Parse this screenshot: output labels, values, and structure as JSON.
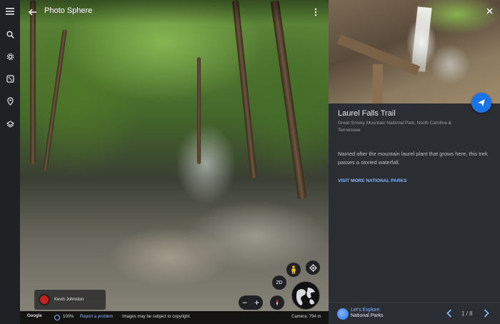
{
  "viewer": {
    "title": "Photo Sphere",
    "contributor": "Kevin Johnston",
    "controls": {
      "zoom_minus": "−",
      "zoom_plus": "+",
      "mode_2d": "2D"
    },
    "footer": {
      "logo": "Google",
      "zoom_percent": "100%",
      "report": "Report a problem",
      "copyright": "Images may be subject to copyright.",
      "camera": "Camera: 794 m"
    }
  },
  "panel": {
    "title": "Laurel Falls Trail",
    "subtitle": "Great Smoky Mountain National Park, North Carolina & Tennessee",
    "description": "Named after the mountain laurel plant that grows here, this trek passes a storied waterfall.",
    "link": "VISIT MORE NATIONAL PARKS",
    "footer": {
      "explore_line1": "Let's Explore:",
      "explore_line2": "National Parks",
      "page": "1 / 8"
    }
  },
  "rail": {
    "icons": [
      "menu-icon",
      "search-icon",
      "settings-icon",
      "voyager-icon",
      "pin-icon",
      "layers-icon"
    ]
  },
  "colors": {
    "accent": "#1a73e8",
    "link": "#8ab4f8",
    "panel_bg": "#2a2e33",
    "rail_bg": "#202124"
  }
}
